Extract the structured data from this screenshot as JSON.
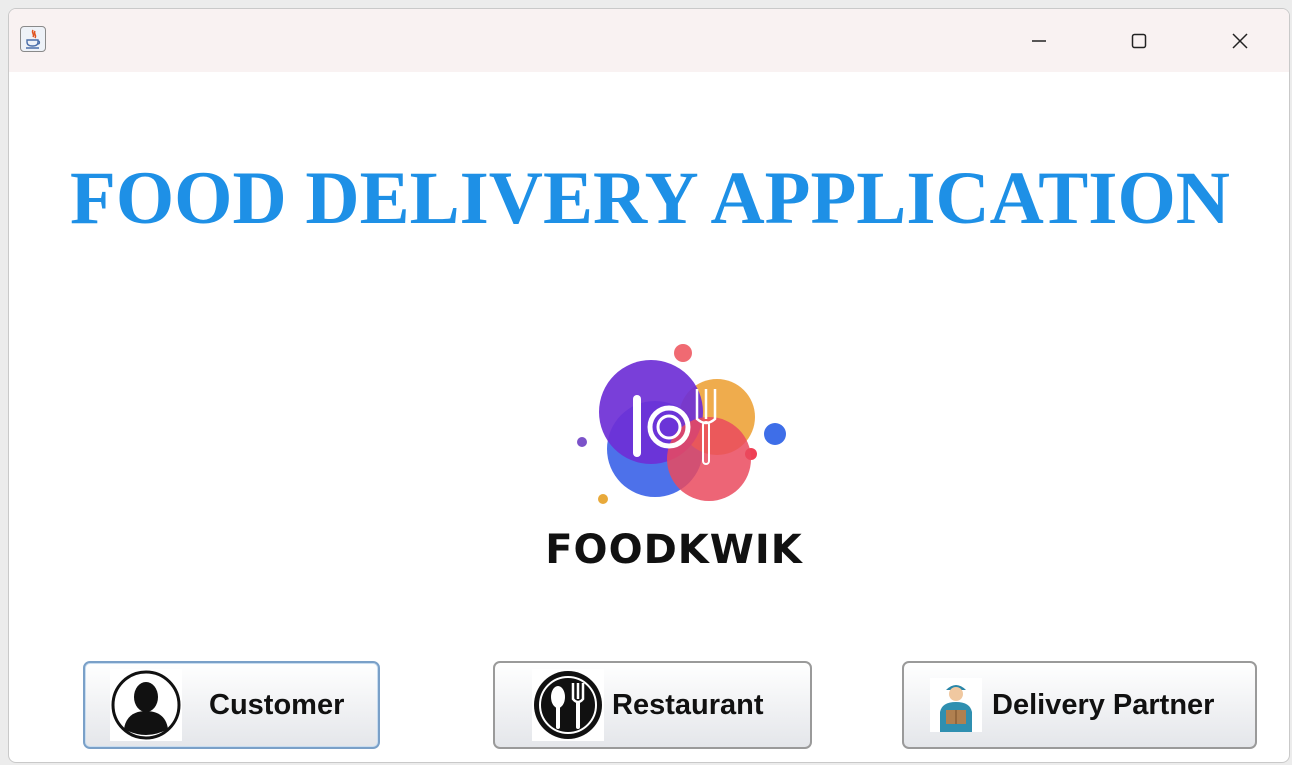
{
  "window": {
    "app_icon": "java-icon",
    "controls": [
      "minimize-icon",
      "maximize-icon",
      "close-icon"
    ]
  },
  "main": {
    "title": "FOOD DELIVERY APPLICATION",
    "logo_text": "FOODKWIK"
  },
  "buttons": {
    "customer_label": "Customer",
    "restaurant_label": "Restaurant",
    "delivery_label": "Delivery Partner"
  },
  "colors": {
    "title": "#1e90e6",
    "titlebar": "#f9f2f2"
  }
}
